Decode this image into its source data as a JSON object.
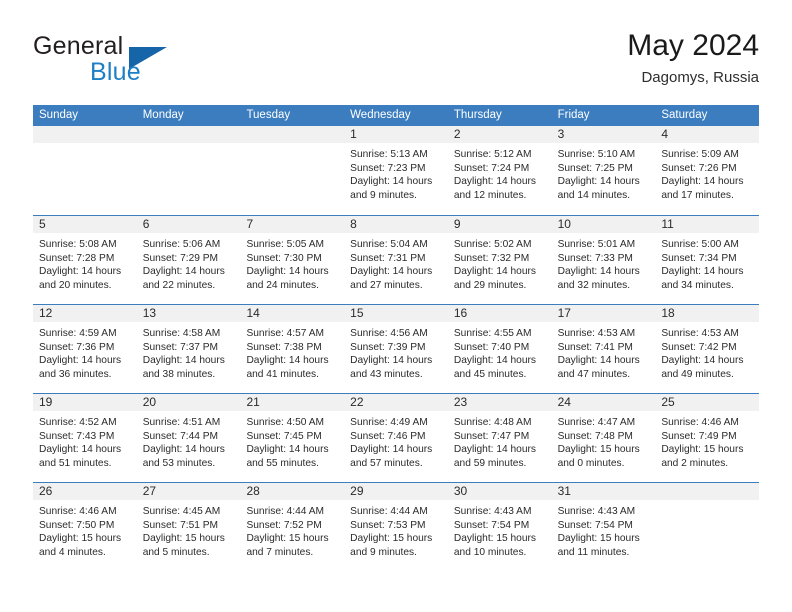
{
  "brand": {
    "name_part1": "General",
    "name_part2": "Blue",
    "logo_icon": "triangle-logo-icon"
  },
  "header": {
    "title": "May 2024",
    "subtitle": "Dagomys, Russia"
  },
  "calendar": {
    "weekday_headers": [
      "Sunday",
      "Monday",
      "Tuesday",
      "Wednesday",
      "Thursday",
      "Friday",
      "Saturday"
    ],
    "accent_color": "#3c7dbf",
    "daynum_band_color": "#f1f1f1",
    "weeks": [
      [
        {
          "day": "",
          "sunrise": "",
          "sunset": "",
          "daylight1": "",
          "daylight2": ""
        },
        {
          "day": "",
          "sunrise": "",
          "sunset": "",
          "daylight1": "",
          "daylight2": ""
        },
        {
          "day": "",
          "sunrise": "",
          "sunset": "",
          "daylight1": "",
          "daylight2": ""
        },
        {
          "day": "1",
          "sunrise": "Sunrise: 5:13 AM",
          "sunset": "Sunset: 7:23 PM",
          "daylight1": "Daylight: 14 hours",
          "daylight2": "and 9 minutes."
        },
        {
          "day": "2",
          "sunrise": "Sunrise: 5:12 AM",
          "sunset": "Sunset: 7:24 PM",
          "daylight1": "Daylight: 14 hours",
          "daylight2": "and 12 minutes."
        },
        {
          "day": "3",
          "sunrise": "Sunrise: 5:10 AM",
          "sunset": "Sunset: 7:25 PM",
          "daylight1": "Daylight: 14 hours",
          "daylight2": "and 14 minutes."
        },
        {
          "day": "4",
          "sunrise": "Sunrise: 5:09 AM",
          "sunset": "Sunset: 7:26 PM",
          "daylight1": "Daylight: 14 hours",
          "daylight2": "and 17 minutes."
        }
      ],
      [
        {
          "day": "5",
          "sunrise": "Sunrise: 5:08 AM",
          "sunset": "Sunset: 7:28 PM",
          "daylight1": "Daylight: 14 hours",
          "daylight2": "and 20 minutes."
        },
        {
          "day": "6",
          "sunrise": "Sunrise: 5:06 AM",
          "sunset": "Sunset: 7:29 PM",
          "daylight1": "Daylight: 14 hours",
          "daylight2": "and 22 minutes."
        },
        {
          "day": "7",
          "sunrise": "Sunrise: 5:05 AM",
          "sunset": "Sunset: 7:30 PM",
          "daylight1": "Daylight: 14 hours",
          "daylight2": "and 24 minutes."
        },
        {
          "day": "8",
          "sunrise": "Sunrise: 5:04 AM",
          "sunset": "Sunset: 7:31 PM",
          "daylight1": "Daylight: 14 hours",
          "daylight2": "and 27 minutes."
        },
        {
          "day": "9",
          "sunrise": "Sunrise: 5:02 AM",
          "sunset": "Sunset: 7:32 PM",
          "daylight1": "Daylight: 14 hours",
          "daylight2": "and 29 minutes."
        },
        {
          "day": "10",
          "sunrise": "Sunrise: 5:01 AM",
          "sunset": "Sunset: 7:33 PM",
          "daylight1": "Daylight: 14 hours",
          "daylight2": "and 32 minutes."
        },
        {
          "day": "11",
          "sunrise": "Sunrise: 5:00 AM",
          "sunset": "Sunset: 7:34 PM",
          "daylight1": "Daylight: 14 hours",
          "daylight2": "and 34 minutes."
        }
      ],
      [
        {
          "day": "12",
          "sunrise": "Sunrise: 4:59 AM",
          "sunset": "Sunset: 7:36 PM",
          "daylight1": "Daylight: 14 hours",
          "daylight2": "and 36 minutes."
        },
        {
          "day": "13",
          "sunrise": "Sunrise: 4:58 AM",
          "sunset": "Sunset: 7:37 PM",
          "daylight1": "Daylight: 14 hours",
          "daylight2": "and 38 minutes."
        },
        {
          "day": "14",
          "sunrise": "Sunrise: 4:57 AM",
          "sunset": "Sunset: 7:38 PM",
          "daylight1": "Daylight: 14 hours",
          "daylight2": "and 41 minutes."
        },
        {
          "day": "15",
          "sunrise": "Sunrise: 4:56 AM",
          "sunset": "Sunset: 7:39 PM",
          "daylight1": "Daylight: 14 hours",
          "daylight2": "and 43 minutes."
        },
        {
          "day": "16",
          "sunrise": "Sunrise: 4:55 AM",
          "sunset": "Sunset: 7:40 PM",
          "daylight1": "Daylight: 14 hours",
          "daylight2": "and 45 minutes."
        },
        {
          "day": "17",
          "sunrise": "Sunrise: 4:53 AM",
          "sunset": "Sunset: 7:41 PM",
          "daylight1": "Daylight: 14 hours",
          "daylight2": "and 47 minutes."
        },
        {
          "day": "18",
          "sunrise": "Sunrise: 4:53 AM",
          "sunset": "Sunset: 7:42 PM",
          "daylight1": "Daylight: 14 hours",
          "daylight2": "and 49 minutes."
        }
      ],
      [
        {
          "day": "19",
          "sunrise": "Sunrise: 4:52 AM",
          "sunset": "Sunset: 7:43 PM",
          "daylight1": "Daylight: 14 hours",
          "daylight2": "and 51 minutes."
        },
        {
          "day": "20",
          "sunrise": "Sunrise: 4:51 AM",
          "sunset": "Sunset: 7:44 PM",
          "daylight1": "Daylight: 14 hours",
          "daylight2": "and 53 minutes."
        },
        {
          "day": "21",
          "sunrise": "Sunrise: 4:50 AM",
          "sunset": "Sunset: 7:45 PM",
          "daylight1": "Daylight: 14 hours",
          "daylight2": "and 55 minutes."
        },
        {
          "day": "22",
          "sunrise": "Sunrise: 4:49 AM",
          "sunset": "Sunset: 7:46 PM",
          "daylight1": "Daylight: 14 hours",
          "daylight2": "and 57 minutes."
        },
        {
          "day": "23",
          "sunrise": "Sunrise: 4:48 AM",
          "sunset": "Sunset: 7:47 PM",
          "daylight1": "Daylight: 14 hours",
          "daylight2": "and 59 minutes."
        },
        {
          "day": "24",
          "sunrise": "Sunrise: 4:47 AM",
          "sunset": "Sunset: 7:48 PM",
          "daylight1": "Daylight: 15 hours",
          "daylight2": "and 0 minutes."
        },
        {
          "day": "25",
          "sunrise": "Sunrise: 4:46 AM",
          "sunset": "Sunset: 7:49 PM",
          "daylight1": "Daylight: 15 hours",
          "daylight2": "and 2 minutes."
        }
      ],
      [
        {
          "day": "26",
          "sunrise": "Sunrise: 4:46 AM",
          "sunset": "Sunset: 7:50 PM",
          "daylight1": "Daylight: 15 hours",
          "daylight2": "and 4 minutes."
        },
        {
          "day": "27",
          "sunrise": "Sunrise: 4:45 AM",
          "sunset": "Sunset: 7:51 PM",
          "daylight1": "Daylight: 15 hours",
          "daylight2": "and 5 minutes."
        },
        {
          "day": "28",
          "sunrise": "Sunrise: 4:44 AM",
          "sunset": "Sunset: 7:52 PM",
          "daylight1": "Daylight: 15 hours",
          "daylight2": "and 7 minutes."
        },
        {
          "day": "29",
          "sunrise": "Sunrise: 4:44 AM",
          "sunset": "Sunset: 7:53 PM",
          "daylight1": "Daylight: 15 hours",
          "daylight2": "and 9 minutes."
        },
        {
          "day": "30",
          "sunrise": "Sunrise: 4:43 AM",
          "sunset": "Sunset: 7:54 PM",
          "daylight1": "Daylight: 15 hours",
          "daylight2": "and 10 minutes."
        },
        {
          "day": "31",
          "sunrise": "Sunrise: 4:43 AM",
          "sunset": "Sunset: 7:54 PM",
          "daylight1": "Daylight: 15 hours",
          "daylight2": "and 11 minutes."
        },
        {
          "day": "",
          "sunrise": "",
          "sunset": "",
          "daylight1": "",
          "daylight2": ""
        }
      ]
    ]
  }
}
